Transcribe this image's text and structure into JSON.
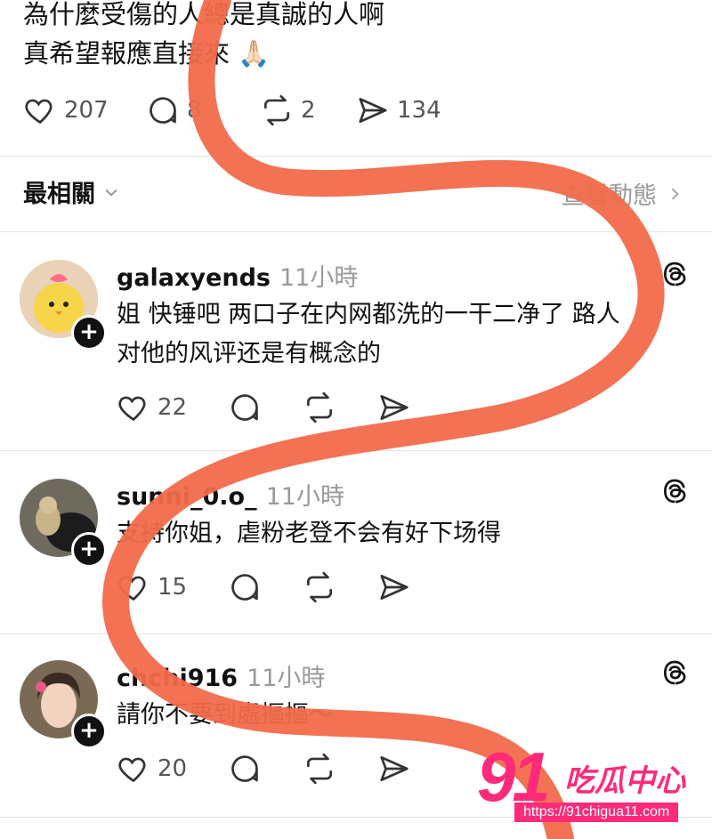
{
  "post": {
    "text_line1": "為什麼受傷的人總是真誠的人啊",
    "text_line2": "真希望報應直接來",
    "emoji": "🙏🏻",
    "likes": "207",
    "comments": "8",
    "reposts": "2",
    "shares": "134"
  },
  "sort": {
    "label": "最相關",
    "view_activity": "查看動態"
  },
  "replies": [
    {
      "username": "galaxyends",
      "time": "11小時",
      "line1": "姐 快锤吧 两口子在内网都洗的一干二净了 路人",
      "line2": "对他的风评还是有概念的",
      "likes": "22"
    },
    {
      "username": "sunni_0.o_",
      "time": "11小時",
      "line1": "支持你姐，虐粉老登不会有好下场得",
      "likes": "15"
    },
    {
      "username": "chchi916",
      "time": "11小時",
      "line1": "請你不要到處摳摳～",
      "likes": "20"
    }
  ],
  "watermark": {
    "number": "91",
    "name": "吃瓜中心",
    "url": "https://91chigua11.com"
  },
  "colors": {
    "scribble": "#f26a4b",
    "brand_pink": "#ff2a7a"
  }
}
